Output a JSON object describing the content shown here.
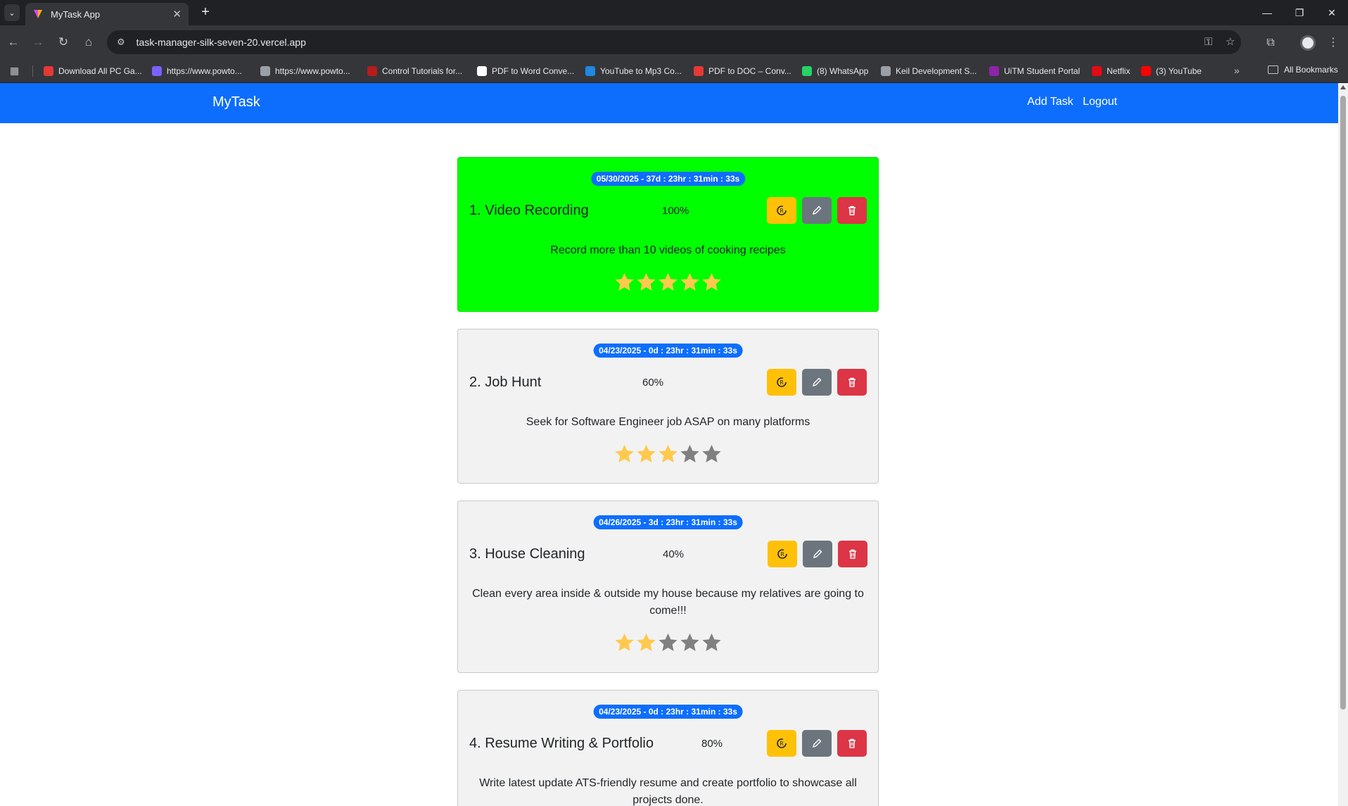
{
  "browser": {
    "tab_title": "MyTask App",
    "url": "task-manager-silk-seven-20.vercel.app",
    "bookmarks": [
      {
        "label": "Download All PC Ga...",
        "color": "#e53935"
      },
      {
        "label": "https://www.powto...",
        "color": "#7b61ff"
      },
      {
        "label": "https://www.powto...",
        "color": "#9aa0a6"
      },
      {
        "label": "Control Tutorials for...",
        "color": "#b71c1c"
      },
      {
        "label": "PDF to Word Conve...",
        "color": "#ffffff"
      },
      {
        "label": "YouTube to Mp3 Co...",
        "color": "#1e88e5"
      },
      {
        "label": "PDF to DOC – Conv...",
        "color": "#e53935"
      },
      {
        "label": "(8) WhatsApp",
        "color": "#25d366"
      },
      {
        "label": "Keil Development S...",
        "color": "#9aa0a6"
      },
      {
        "label": "UiTM Student Portal",
        "color": "#8e24aa"
      },
      {
        "label": "Netflix",
        "color": "#e50914"
      },
      {
        "label": "(3) YouTube",
        "color": "#ff0000"
      }
    ],
    "all_bookmarks_label": "All Bookmarks"
  },
  "navbar": {
    "brand": "MyTask",
    "links": [
      "Add Task",
      "Logout"
    ]
  },
  "colors": {
    "primary": "#0d6efd",
    "completed_card": "#00ff00",
    "star_filled": "#ffc94d",
    "star_empty": "#808080"
  },
  "tasks": [
    {
      "badge": "05/30/2025 - 37d : 23hr : 31min : 33s",
      "title": "1. Video Recording",
      "percent": "100%",
      "description": "Record more than 10 videos of cooking recipes",
      "rating": 5,
      "completed": true
    },
    {
      "badge": "04/23/2025 - 0d : 23hr : 31min : 33s",
      "title": "2. Job Hunt",
      "percent": "60%",
      "description": "Seek for Software Engineer job ASAP on many platforms",
      "rating": 3,
      "completed": false
    },
    {
      "badge": "04/26/2025 - 3d : 23hr : 31min : 33s",
      "title": "3. House Cleaning",
      "percent": "40%",
      "description": "Clean every area inside & outside my house because my relatives are going to come!!!",
      "rating": 2,
      "completed": false
    },
    {
      "badge": "04/23/2025 - 0d : 23hr : 31min : 33s",
      "title": "4. Resume Writing & Portfolio",
      "percent": "80%",
      "description": "Write latest update ATS-friendly resume and create portfolio to showcase all projects done.",
      "rating": null,
      "completed": false
    }
  ]
}
